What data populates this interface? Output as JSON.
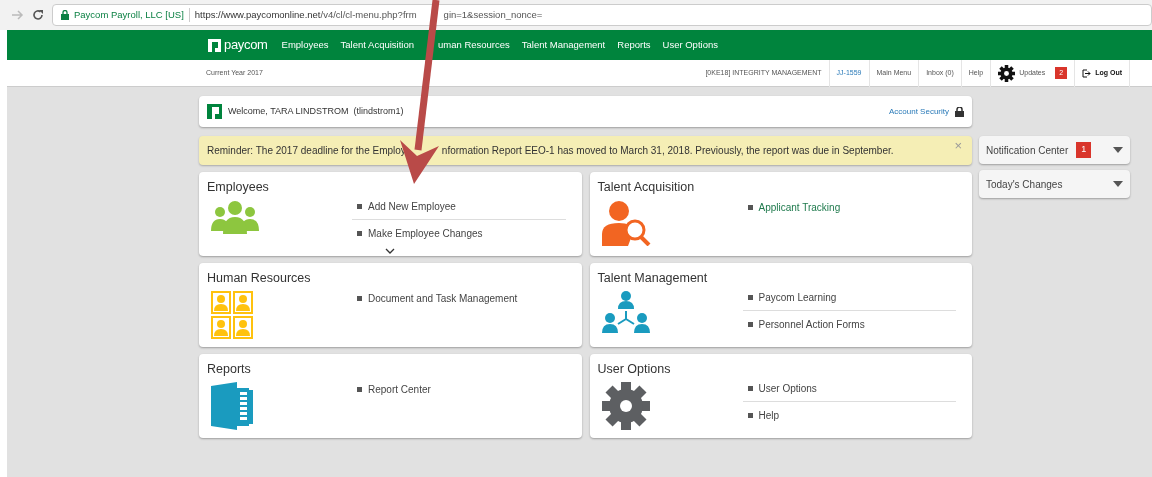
{
  "browser": {
    "site_label": "Paycom Payroll, LLC [US]",
    "url_host": "https://www.paycomonline.net",
    "url_path": "/v4/cl/cl-menu.php?frm",
    "url_rest": "gin=1&session_nonce="
  },
  "nav": {
    "logo": "paycom",
    "items": [
      "Employees",
      "Talent Acquisition",
      "uman Resources",
      "Talent Management",
      "Reports",
      "User Options"
    ]
  },
  "subheader": {
    "current_year": "Current Year 2017",
    "items": [
      {
        "kind": "text",
        "label": "[0KE18] INTEGRITY MANAGEMENT"
      },
      {
        "kind": "link",
        "label": "JJ-1559"
      },
      {
        "kind": "text",
        "label": "Main Menu"
      },
      {
        "kind": "text",
        "label": "Inbox (0)"
      },
      {
        "kind": "text",
        "label": "Help"
      },
      {
        "kind": "updates",
        "label": "Updates",
        "badge": "2"
      },
      {
        "kind": "logout",
        "label": "Log Out"
      }
    ]
  },
  "welcome": {
    "text": "Welcome, TARA LINDSTROM  (tlindstrom1)",
    "account_security": "Account Security"
  },
  "reminder": {
    "text_before": "Reminder: The 2017 deadline for the Employ",
    "text_after": "nformation Report EEO-1 has moved to March 31, 2018. Previously, the report was due in September.",
    "close": "×"
  },
  "cards": [
    {
      "title": "Employees",
      "kind": "people",
      "more": true,
      "links": [
        {
          "label": "Add New Employee",
          "color": "#444444"
        },
        {
          "label": "Make Employee Changes",
          "color": "#444444"
        }
      ]
    },
    {
      "title": "Talent Acquisition",
      "kind": "search-person",
      "more": false,
      "links": [
        {
          "label": "Applicant Tracking",
          "color": "#1f7a4d"
        }
      ]
    },
    {
      "title": "Human Resources",
      "kind": "badges",
      "more": false,
      "links": [
        {
          "label": "Document and Task Management",
          "color": "#444444"
        }
      ]
    },
    {
      "title": "Talent Management",
      "kind": "network",
      "more": false,
      "links": [
        {
          "label": "Paycom Learning",
          "color": "#444444"
        },
        {
          "label": "Personnel Action Forms",
          "color": "#444444"
        }
      ]
    },
    {
      "title": "Reports",
      "kind": "report",
      "more": false,
      "links": [
        {
          "label": "Report Center",
          "color": "#444444"
        }
      ]
    },
    {
      "title": "User Options",
      "kind": "gear",
      "more": false,
      "links": [
        {
          "label": "User Options",
          "color": "#444444"
        },
        {
          "label": "Help",
          "color": "#444444"
        }
      ]
    }
  ],
  "side_panels": [
    {
      "title": "Notification Center",
      "badge": "1"
    },
    {
      "title": "Today's Changes"
    }
  ]
}
